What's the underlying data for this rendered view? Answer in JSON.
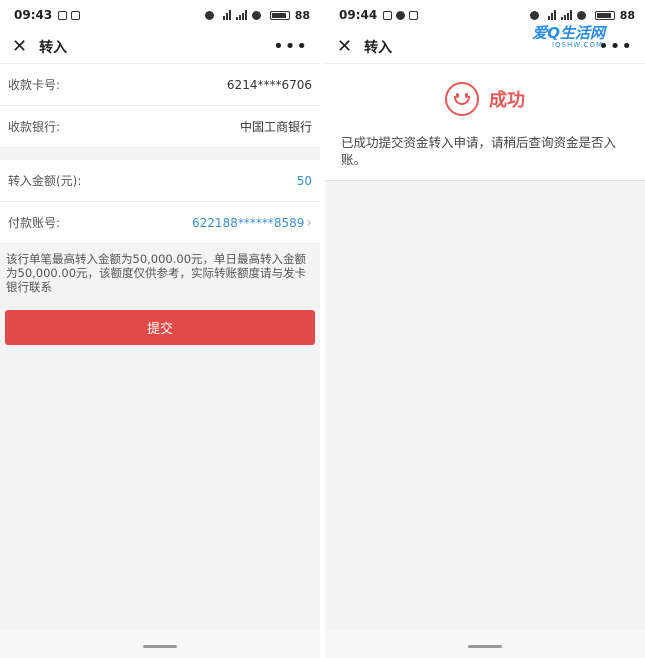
{
  "left": {
    "status": {
      "time": "09:43",
      "battery": "88"
    },
    "title": "转入",
    "rows1": [
      {
        "label": "收款卡号:",
        "value": "6214****6706"
      },
      {
        "label": "收款银行:",
        "value": "中国工商银行"
      }
    ],
    "amount": {
      "label": "转入金额(元):",
      "value": "50"
    },
    "account": {
      "label": "付款账号:",
      "value": "622188******8589"
    },
    "notice": "该行单笔最高转入金额为50,000.00元，单日最高转入金额为50,000.00元，该额度仅供参考，实际转账额度请与发卡银行联系",
    "submit_label": "提交"
  },
  "right": {
    "status": {
      "time": "09:44",
      "battery": "88"
    },
    "title": "转入",
    "result_title": "成功",
    "result_message": "已成功提交资金转入申请，请稍后查询资金是否入账。",
    "brand": "爱Q生活网",
    "brand_sub": "IQSHW.COM"
  },
  "colors": {
    "accent_red": "#e14a46",
    "link_blue": "#3b8fcf"
  }
}
